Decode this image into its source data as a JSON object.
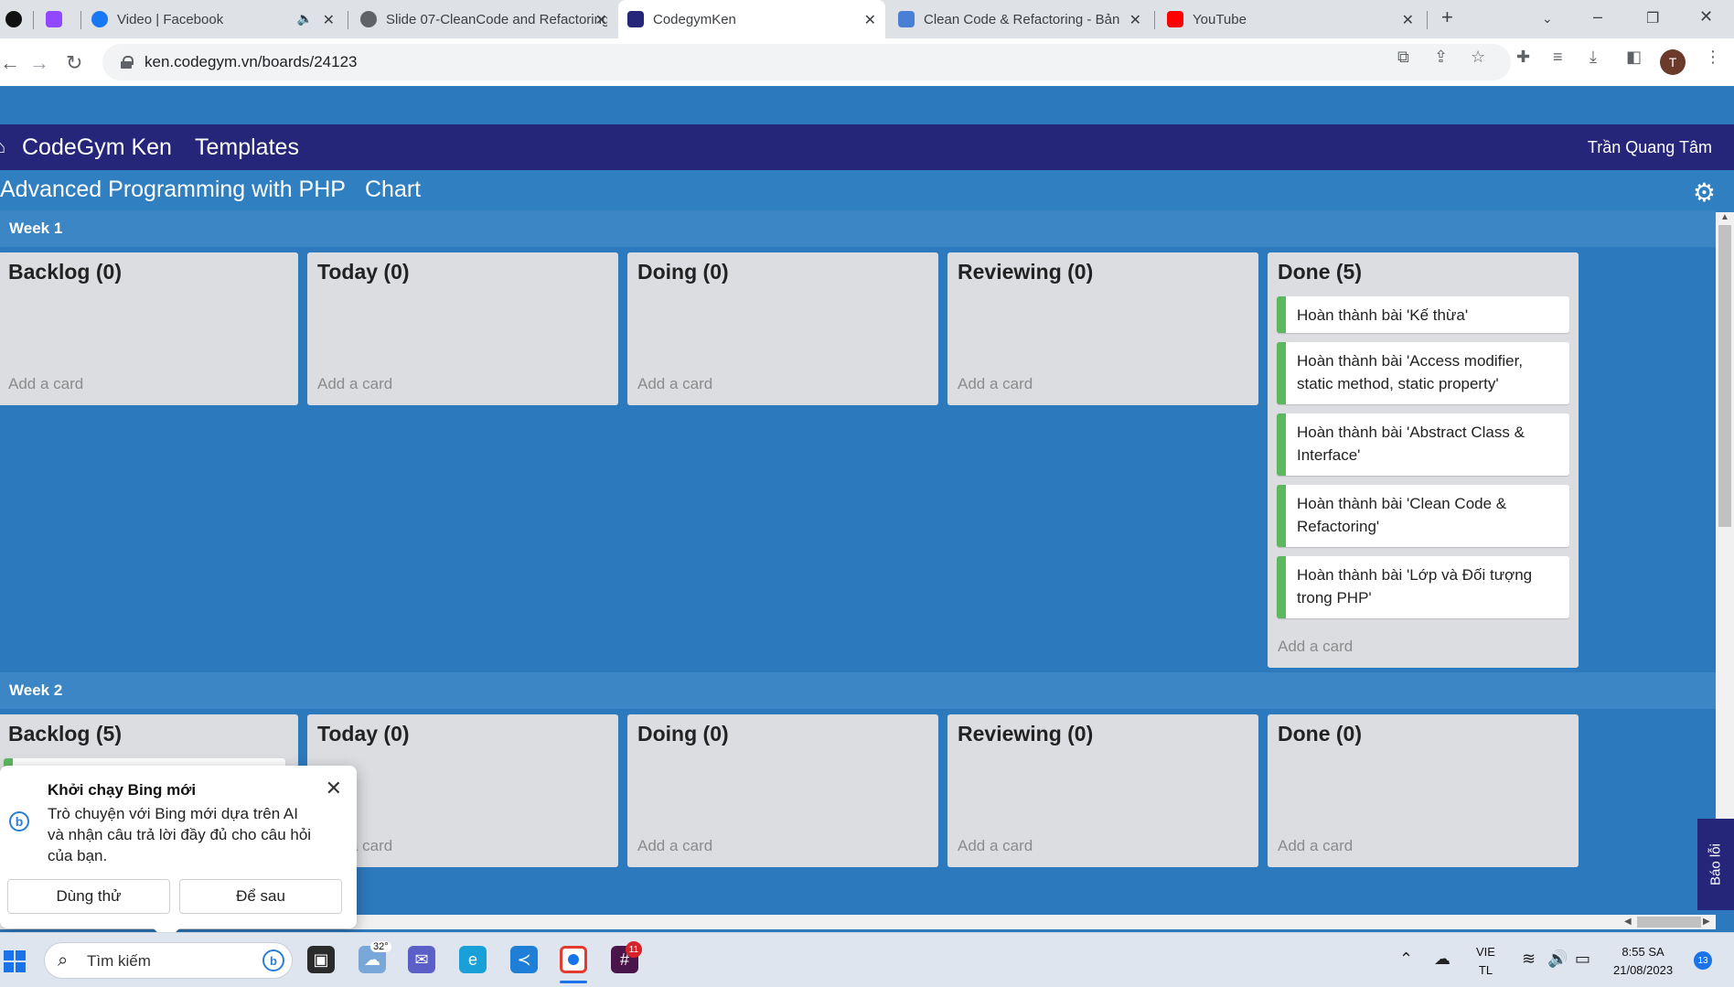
{
  "browser": {
    "tabs": [
      {
        "title": "",
        "favicon_color": "#111111",
        "active": false
      },
      {
        "title": "",
        "favicon_color": "#9146ff",
        "active": false
      },
      {
        "title": "Video | Facebook",
        "favicon_color": "#1877f2",
        "active": false,
        "muted_icon": "speaker-icon"
      },
      {
        "title": "Slide 07-CleanCode and Refactoring",
        "favicon_color": "#5f6368",
        "active": false
      },
      {
        "title": "CodegymKen",
        "favicon_color": "#252679",
        "active": true
      },
      {
        "title": "Clean Code & Refactoring - Bản",
        "favicon_color": "#4a7fd6",
        "active": false
      },
      {
        "title": "YouTube",
        "favicon_color": "#ff0000",
        "active": false
      }
    ],
    "url": "ken.codegym.vn/boards/24123",
    "profile_initial": "T"
  },
  "header": {
    "brand": "CodeGym Ken",
    "templates": "Templates",
    "user": "Trần Quang Tâm"
  },
  "board": {
    "title": "Advanced Programming with PHP",
    "chart": "Chart",
    "add_card_label": "Add a card",
    "weeks": [
      {
        "label": "Week 1",
        "lists": [
          {
            "title": "Backlog (0)",
            "cards": []
          },
          {
            "title": "Today (0)",
            "cards": []
          },
          {
            "title": "Doing (0)",
            "cards": []
          },
          {
            "title": "Reviewing (0)",
            "cards": []
          },
          {
            "title": "Done (5)",
            "cards": [
              "Hoàn thành bài 'Kế thừa'",
              "Hoàn thành bài 'Access modifier, static method, static property'",
              "Hoàn thành bài 'Abstract Class & Interface'",
              "Hoàn thành bài 'Clean Code & Refactoring'",
              "Hoàn thành bài 'Lớp và Đối tượng trong PHP'"
            ]
          }
        ]
      },
      {
        "label": "Week 2",
        "lists": [
          {
            "title": "Backlog (5)",
            "cards": []
          },
          {
            "title": "Today (0)",
            "cards": []
          },
          {
            "title": "Doing (0)",
            "cards": []
          },
          {
            "title": "Reviewing (0)",
            "cards": []
          },
          {
            "title": "Done (0)",
            "cards": []
          }
        ]
      }
    ]
  },
  "report_tab": "Báo lỗi",
  "bing_popup": {
    "title": "Khởi chạy Bing mới",
    "body": "Trò chuyện với Bing mới dựa trên AI và nhận câu trả lời đầy đủ cho câu hỏi của bạn.",
    "try_button": "Dùng thử",
    "later_button": "Để sau"
  },
  "taskbar": {
    "search_placeholder": "Tìm kiếm",
    "weather_temp": "32°",
    "app_badge": "11",
    "lang_line1": "VIE",
    "lang_line2": "TL",
    "time": "8:55 SA",
    "date": "21/08/2023",
    "notification_count": "13"
  },
  "colors": {
    "header": "#252679",
    "board_bg": "#2d79bd",
    "list_bg": "#dcdde1",
    "card_accent": "#5cb85c"
  }
}
